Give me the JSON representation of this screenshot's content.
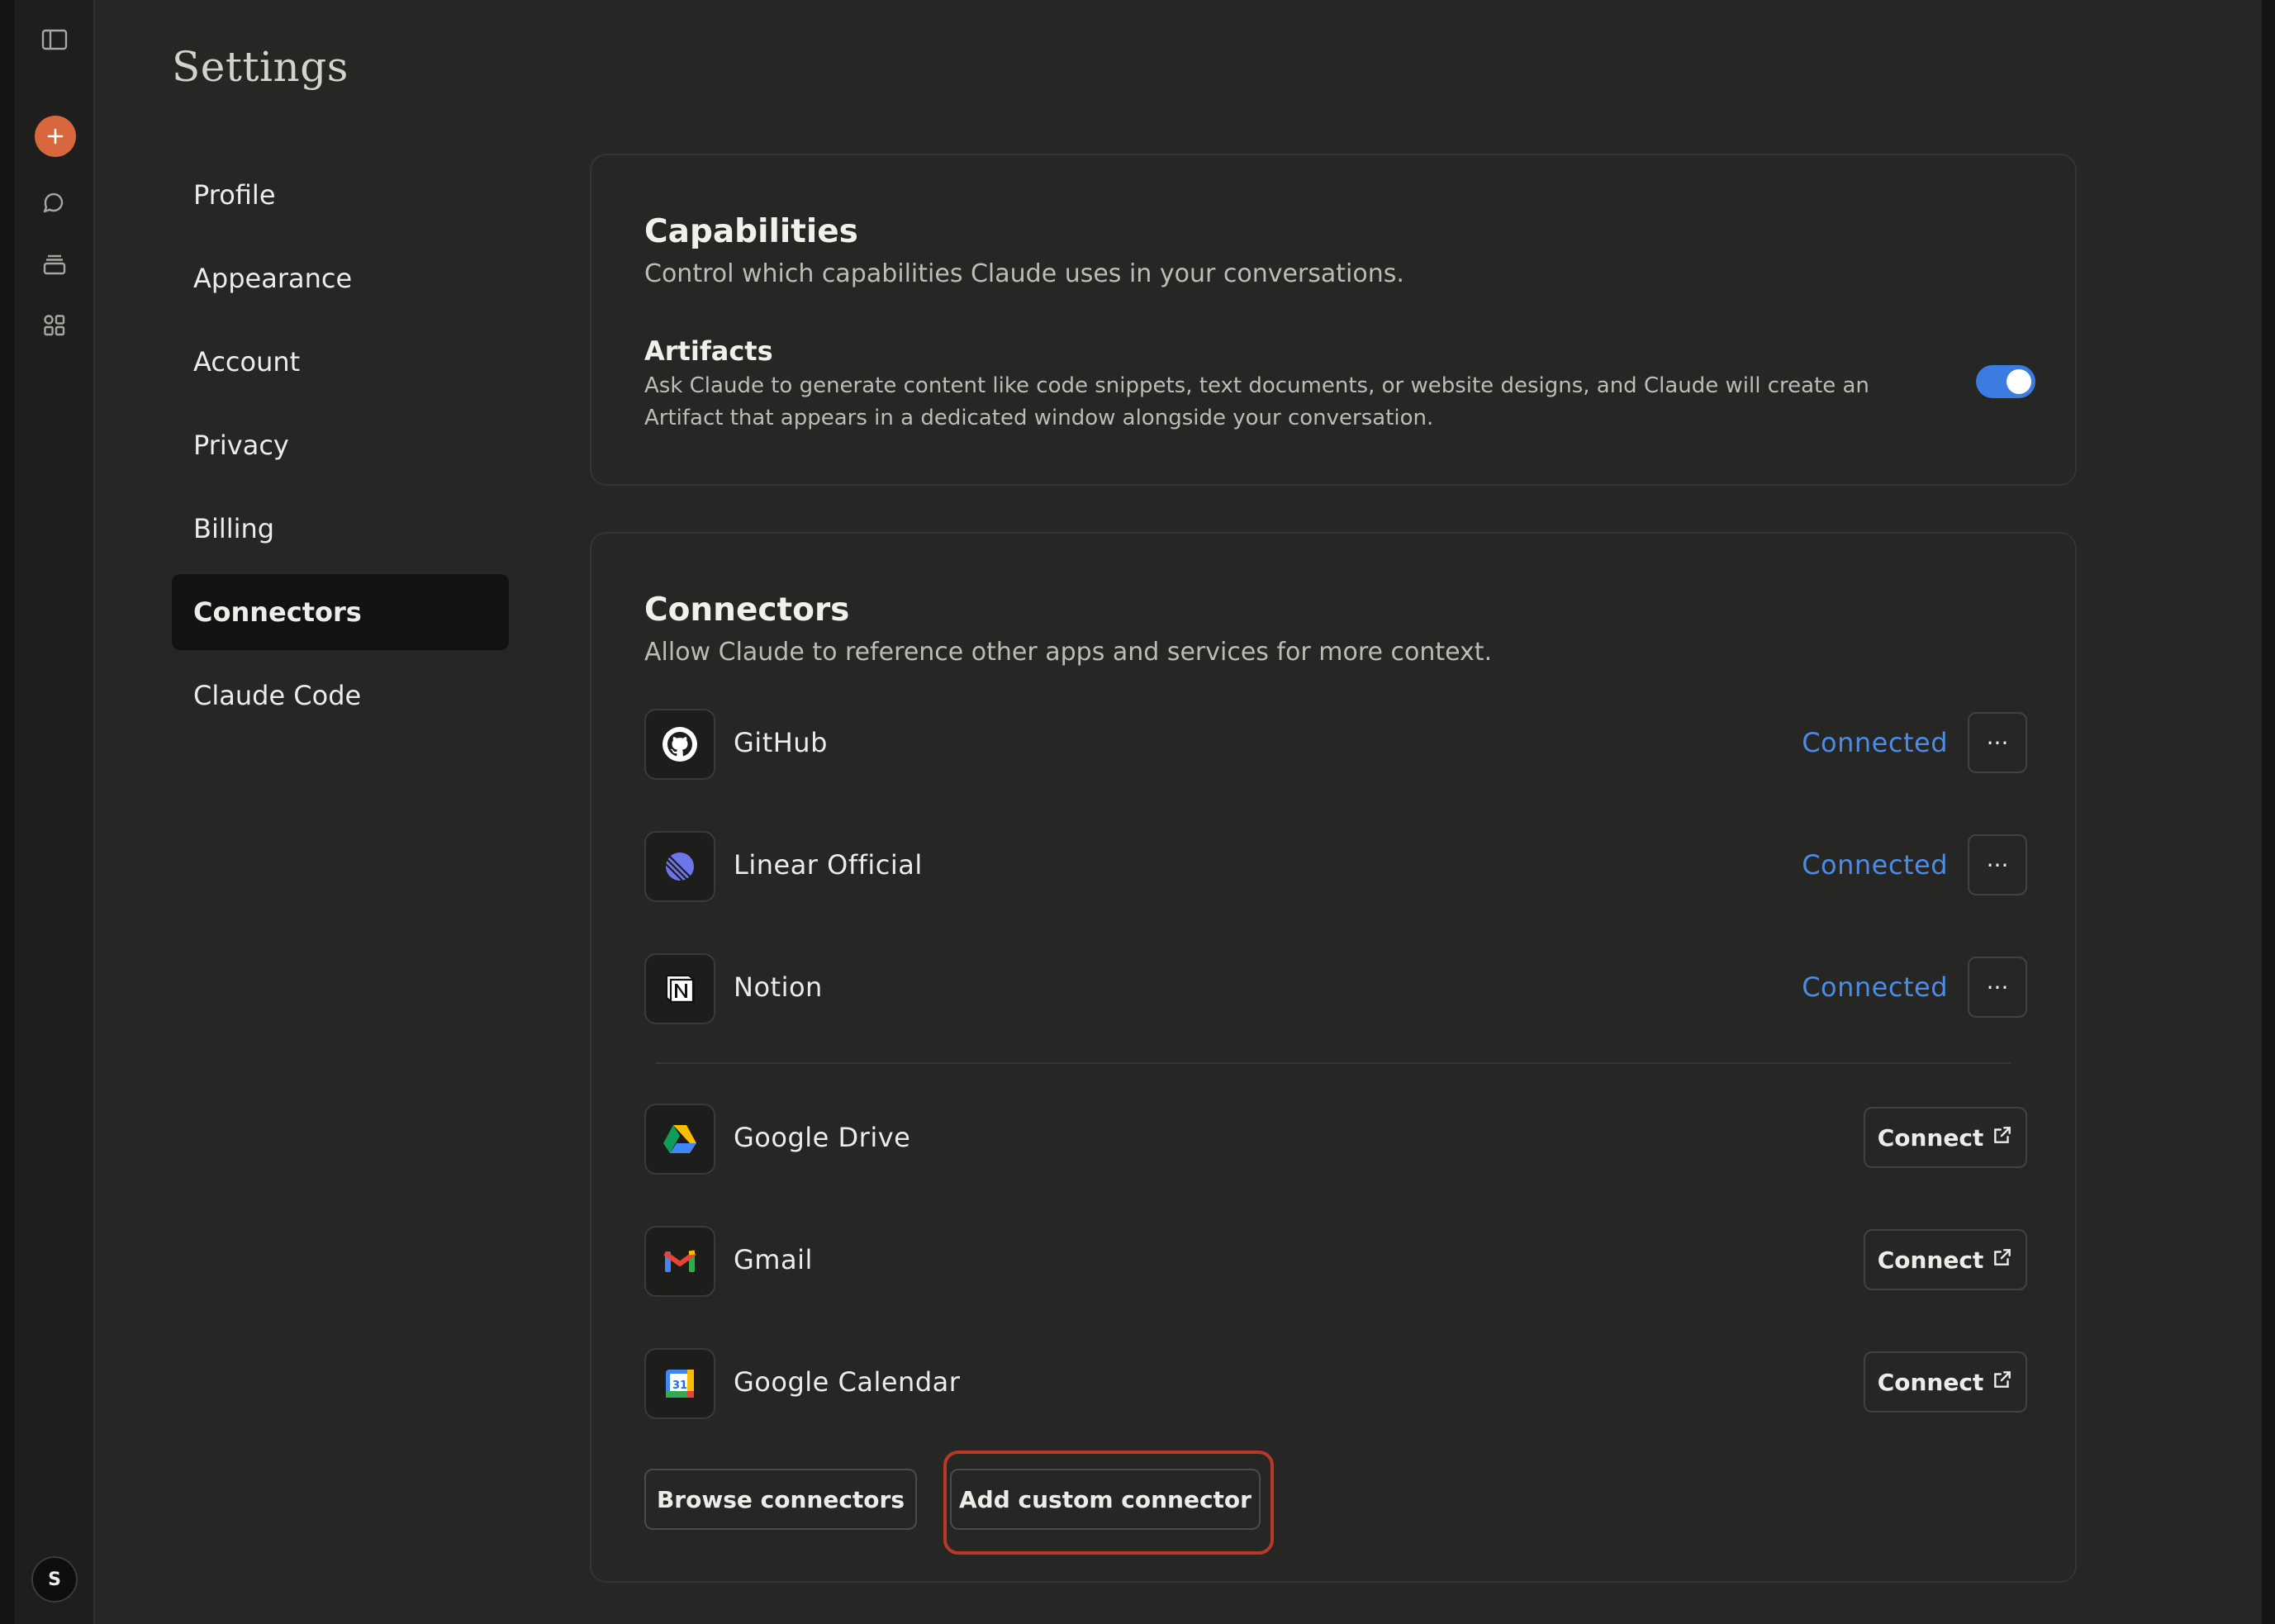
{
  "page_title": "Settings",
  "rail": {
    "icons": [
      "sidebar-toggle-icon",
      "new-chat-icon",
      "chats-icon",
      "projects-icon",
      "artifacts-icon"
    ],
    "avatar_letter": "S",
    "accent_color": "#D9673E"
  },
  "nav": {
    "items": [
      "Profile",
      "Appearance",
      "Account",
      "Privacy",
      "Billing",
      "Connectors",
      "Claude Code"
    ],
    "active": "Connectors"
  },
  "capabilities": {
    "title": "Capabilities",
    "subtitle": "Control which capabilities Claude uses in your conversations.",
    "artifacts": {
      "title": "Artifacts",
      "description": "Ask Claude to generate content like code snippets, text documents, or website designs, and Claude will create an Artifact that appears in a dedicated window alongside your conversation.",
      "enabled": true,
      "toggle_color": "#3A7CE0"
    }
  },
  "connectors": {
    "title": "Connectors",
    "subtitle": "Allow Claude to reference other apps and services for more context.",
    "connected": [
      {
        "name": "GitHub",
        "status": "Connected",
        "more": "···",
        "icon": "github-icon"
      },
      {
        "name": "Linear Official",
        "status": "Connected",
        "more": "···",
        "icon": "linear-icon"
      },
      {
        "name": "Notion",
        "status": "Connected",
        "more": "···",
        "icon": "notion-icon"
      }
    ],
    "available": [
      {
        "name": "Google Drive",
        "action": "Connect",
        "icon": "google-drive-icon"
      },
      {
        "name": "Gmail",
        "action": "Connect",
        "icon": "gmail-icon"
      },
      {
        "name": "Google Calendar",
        "action": "Connect",
        "icon": "google-calendar-icon"
      }
    ],
    "calendar_day": "31",
    "browse_label": "Browse connectors",
    "add_custom_label": "Add custom connector",
    "status_color": "#4C8BE6",
    "highlight_color": "#B8382A"
  }
}
